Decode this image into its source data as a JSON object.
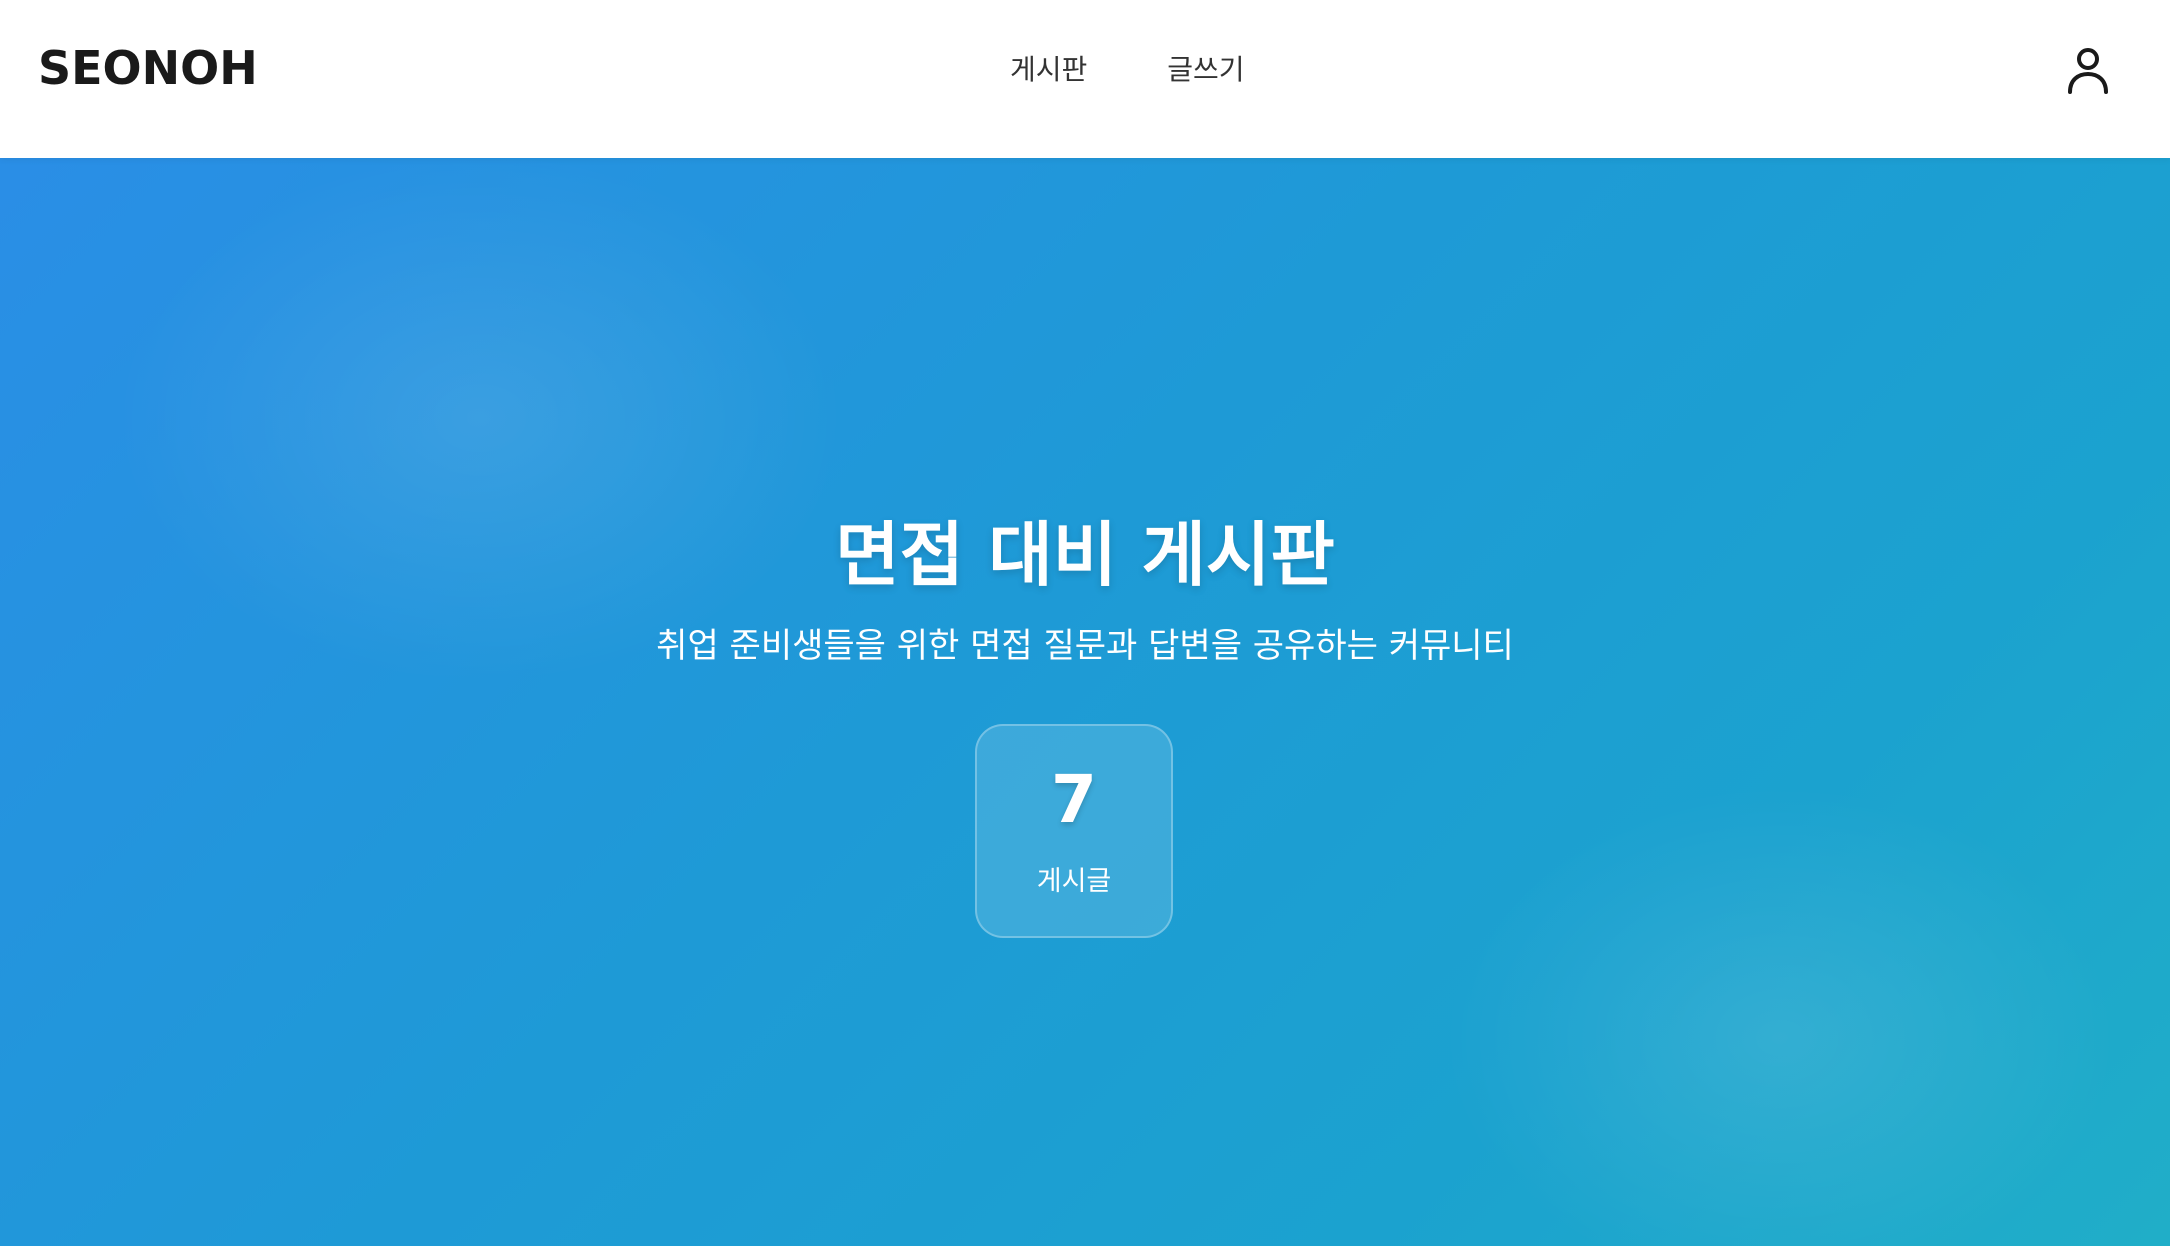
{
  "header": {
    "logo": "SEONOH",
    "nav": [
      {
        "label": "게시판"
      },
      {
        "label": "글쓰기"
      }
    ],
    "user_icon": "user-icon"
  },
  "hero": {
    "title": "면접 대비 게시판",
    "subtitle": "취업 준비생들을 위한 면접 질문과 답변을 공유하는 커뮤니티",
    "stats": [
      {
        "value": "7",
        "label": "게시글"
      }
    ]
  },
  "colors": {
    "header_bg": "#ffffff",
    "logo_text": "#1a1a1a",
    "nav_text": "#333333",
    "hero_gradient_start": "#2a8ee6",
    "hero_gradient_end": "#20aec8",
    "hero_text": "#ffffff"
  }
}
